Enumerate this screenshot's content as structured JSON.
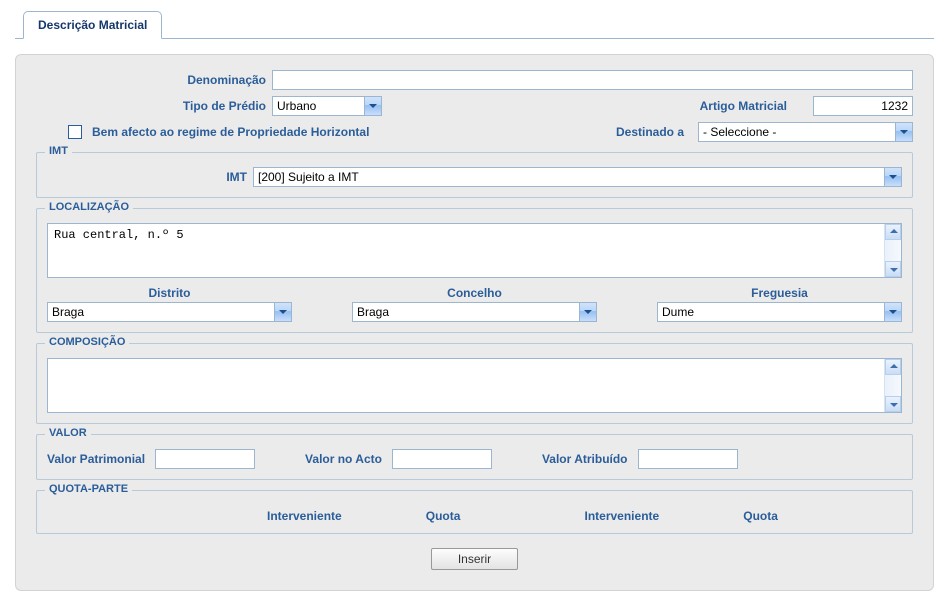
{
  "tab": {
    "label": "Descrição Matricial"
  },
  "fields": {
    "denominacao_label": "Denominação",
    "denominacao_value": "",
    "tipo_predio_label": "Tipo de Prédio",
    "tipo_predio_value": "Urbano",
    "artigo_label": "Artigo Matricial",
    "artigo_value": "1232",
    "bem_afecto_label": "Bem afecto ao regime de Propriedade Horizontal",
    "destinado_label": "Destinado a",
    "destinado_value": "- Seleccione -"
  },
  "imt": {
    "group_label": "IMT",
    "label": "IMT",
    "value": "[200] Sujeito a IMT"
  },
  "localizacao": {
    "group_label": "LOCALIZAÇÃO",
    "endereco": "Rua central, n.º 5",
    "distrito_label": "Distrito",
    "distrito_value": "Braga",
    "concelho_label": "Concelho",
    "concelho_value": "Braga",
    "freguesia_label": "Freguesia",
    "freguesia_value": "Dume"
  },
  "composicao": {
    "group_label": "COMPOSIÇÃO",
    "value": ""
  },
  "valor": {
    "group_label": "VALOR",
    "patrimonial_label": "Valor Patrimonial",
    "patrimonial_value": "",
    "acto_label": "Valor no Acto",
    "acto_value": "",
    "atribuido_label": "Valor Atribuído",
    "atribuido_value": ""
  },
  "quota": {
    "group_label": "QUOTA-PARTE",
    "col_interveniente": "Interveniente",
    "col_quota": "Quota"
  },
  "actions": {
    "inserir": "Inserir"
  }
}
